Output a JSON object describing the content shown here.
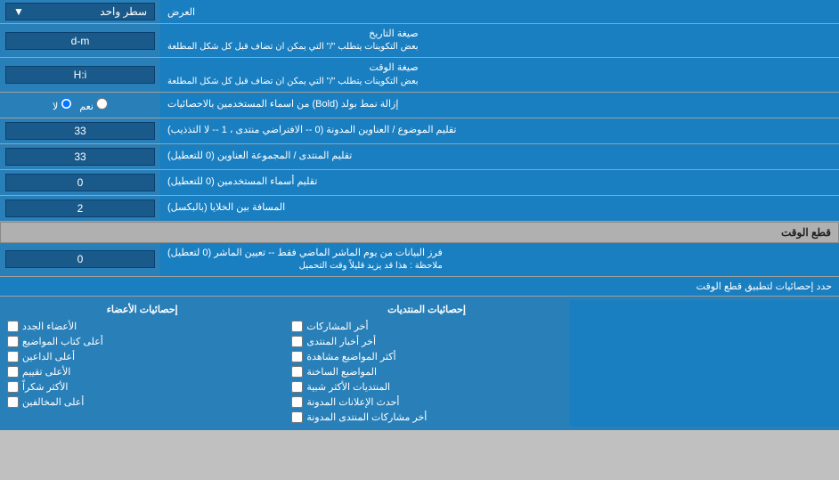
{
  "header": {
    "label": "العرض",
    "dropdown_label": "سطر واحد",
    "dropdown_arrow": "▼"
  },
  "rows": [
    {
      "id": "date_format",
      "label": "صيغة التاريخ",
      "sub_label": "بعض التكوينات يتطلب \"/\" التي يمكن ان تضاف قبل كل شكل المطلعة",
      "value": "d-m"
    },
    {
      "id": "time_format",
      "label": "صيغة الوقت",
      "sub_label": "بعض التكوينات يتطلب \"/\" التي يمكن ان تضاف قبل كل شكل المطلعة",
      "value": "H:i"
    }
  ],
  "radio_row": {
    "label": "إزالة نمط بولد (Bold) من اسماء المستخدمين بالاحصائيات",
    "option_yes": "نعم",
    "option_no": "لا",
    "selected": "no"
  },
  "field_rows": [
    {
      "id": "topics_per_page",
      "label": "تقليم الموضوع / العناوين المدونة (0 -- الافتراضي منتدى ، 1 -- لا التذذيب)",
      "value": "33"
    },
    {
      "id": "forum_per_page",
      "label": "تقليم المنتدى / المجموعة العناوين (0 للتعطيل)",
      "value": "33"
    },
    {
      "id": "users_per_page",
      "label": "تقليم أسماء المستخدمين (0 للتعطيل)",
      "value": "0"
    },
    {
      "id": "gap_between",
      "label": "المسافة بين الخلايا (بالبكسل)",
      "value": "2"
    }
  ],
  "cutoff_section": {
    "title": "قطع الوقت",
    "row": {
      "label": "فرز البيانات من يوم الماشر الماضي فقط -- تعيين الماشر (0 لتعطيل)",
      "sub_label": "ملاحظة : هذا قد يزيد قليلاً وقت التحميل",
      "value": "0"
    }
  },
  "stats_section": {
    "limit_label": "حدد إحصائيات لتطبيق قطع الوقت",
    "col1_header": "إحصائيات المنتديات",
    "col2_header": "إحصائيات الأعضاء",
    "col1_items": [
      "أخر المشاركات",
      "أخر أخبار المنتدى",
      "أكثر المواضيع مشاهدة",
      "المواضيع الساخنة",
      "المنتديات الأكثر شبية",
      "أحدث الإعلانات المدونة",
      "أخر مشاركات المنتدى المدونة"
    ],
    "col2_items": [
      "الأعضاء الجدد",
      "أعلى كتاب المواضيع",
      "أعلى الداعين",
      "الأعلى تقييم",
      "الأكثر شكراً",
      "أعلى المخالفين"
    ]
  }
}
